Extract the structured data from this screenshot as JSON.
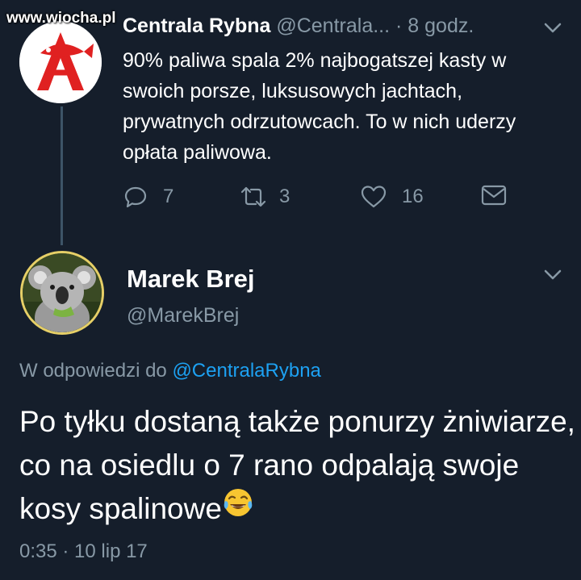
{
  "watermark": "www.wiocha.pl",
  "tweet1": {
    "name": "Centrala Rybna",
    "handle": "@Centrala...",
    "sep": " · ",
    "time": "8 godz.",
    "text": "90% paliwa spala 2% najbogatszej kasty w swoich porsze, luksusowych jachtach, prywatnych odrzutowcach. To w nich uderzy opłata paliwowa.",
    "reply_count": "7",
    "retweet_count": "3",
    "like_count": "16"
  },
  "tweet2": {
    "name": "Marek Brej",
    "handle": "@MarekBrej",
    "reply_prefix": "W odpowiedzi do ",
    "reply_mention": "@CentralaRybna",
    "text": "Po tyłku dostaną także ponurzy żniwiarze, co na osiedlu o 7 rano odpalają swoje kosy spalinowe",
    "emoji": "face-with-tears-of-joy",
    "timestamp": "0:35 · 10 lip 17"
  },
  "colors": {
    "background": "#151e2b",
    "secondary_text": "#8899a6",
    "link": "#1da1f2",
    "thread_line": "#3d5467"
  }
}
